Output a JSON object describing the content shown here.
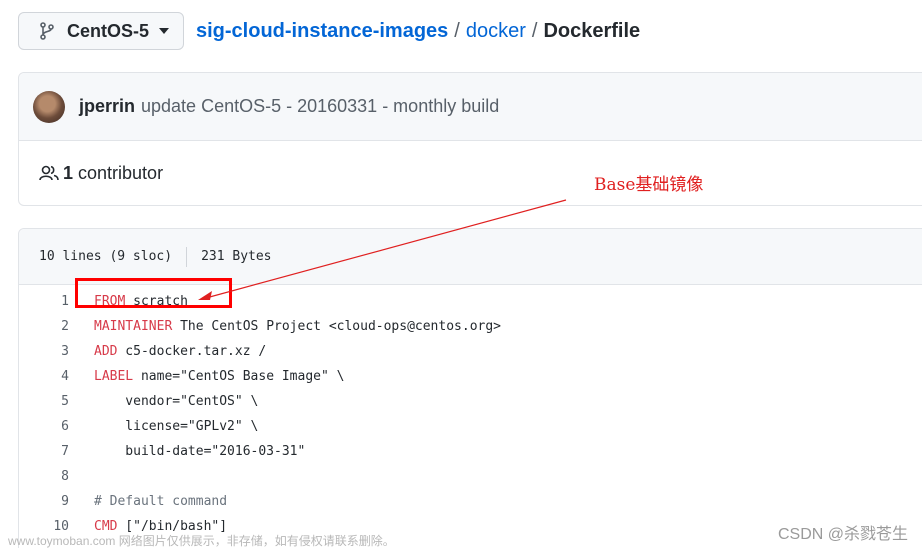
{
  "branch": {
    "label": "CentOS-5"
  },
  "breadcrumb": {
    "repo": "sig-cloud-instance-images",
    "separator": "/",
    "dir": "docker",
    "file": "Dockerfile"
  },
  "commit": {
    "author": "jperrin",
    "message": "update CentOS-5 - 20160331 - monthly build"
  },
  "contributors": {
    "count": "1",
    "label": "contributor"
  },
  "annotation": {
    "label": "Base基础镜像",
    "color": "#e02020"
  },
  "file_info": {
    "lines": "10 lines (9 sloc)",
    "size": "231 Bytes"
  },
  "code_lines": [
    {
      "n": "1",
      "kw": "FROM",
      "text": " scratch"
    },
    {
      "n": "2",
      "kw": "MAINTAINER",
      "text": " The CentOS Project <cloud-ops@centos.org>"
    },
    {
      "n": "3",
      "kw": "ADD",
      "text": " c5-docker.tar.xz /"
    },
    {
      "n": "4",
      "kw": "LABEL",
      "text": " name=\"CentOS Base Image\" \\"
    },
    {
      "n": "5",
      "kw": "",
      "text": "    vendor=\"CentOS\" \\"
    },
    {
      "n": "6",
      "kw": "",
      "text": "    license=\"GPLv2\" \\"
    },
    {
      "n": "7",
      "kw": "",
      "text": "    build-date=\"2016-03-31\""
    },
    {
      "n": "8",
      "kw": "",
      "text": ""
    },
    {
      "n": "9",
      "kw": "",
      "text": "# Default command"
    },
    {
      "n": "10",
      "kw": "CMD",
      "text": " [\"/bin/bash\"]"
    }
  ],
  "watermark": {
    "left": "www.toymoban.com 网络图片仅供展示，非存储，如有侵权请联系删除。",
    "right": "CSDN @杀戮苍生"
  },
  "icons": {
    "branch": "git-branch-icon",
    "caret": "caret-down-icon",
    "people": "people-icon"
  }
}
